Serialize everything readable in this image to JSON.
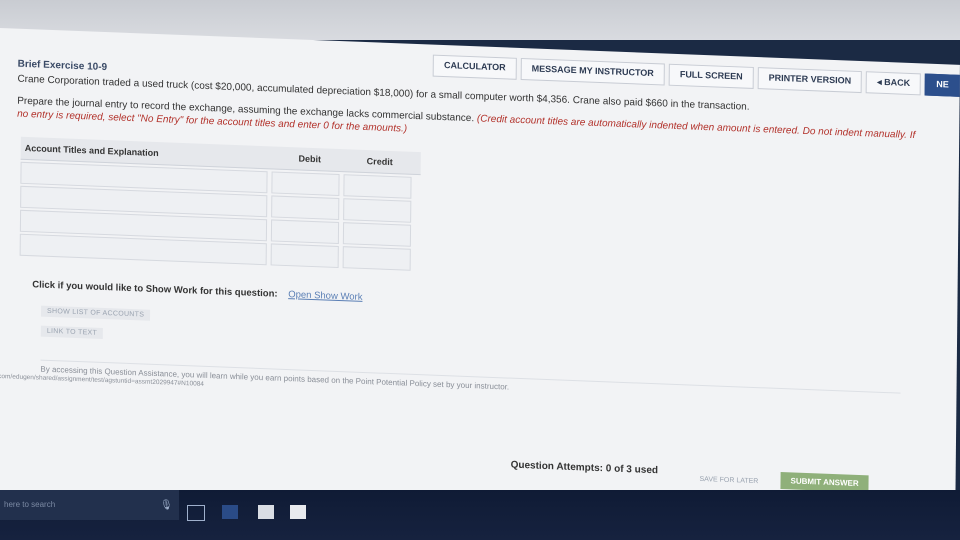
{
  "toolbar": {
    "calculator": "CALCULATOR",
    "message": "MESSAGE MY INSTRUCTOR",
    "fullscreen": "FULL SCREEN",
    "printer": "PRINTER VERSION",
    "back": "◂ BACK",
    "next": "NE"
  },
  "exercise": {
    "title": "Brief Exercise 10-9",
    "description": "Crane Corporation traded a used truck (cost $20,000, accumulated depreciation $18,000) for a small computer worth $4,356. Crane also paid $660 in the transaction.",
    "instruction_a": "Prepare the journal entry to record the exchange, assuming the exchange lacks commercial substance.",
    "instruction_b": "(Credit account titles are automatically indented when amount is entered. Do not indent manually. If no entry is required, select \"No Entry\" for the account titles and enter 0 for the amounts.)"
  },
  "table": {
    "col_account": "Account Titles and Explanation",
    "col_debit": "Debit",
    "col_credit": "Credit",
    "rows": [
      {
        "account": "",
        "debit": "",
        "credit": ""
      },
      {
        "account": "",
        "debit": "",
        "credit": ""
      },
      {
        "account": "",
        "debit": "",
        "credit": ""
      },
      {
        "account": "",
        "debit": "",
        "credit": ""
      }
    ]
  },
  "showwork": {
    "prompt": "Click if you would like to Show Work for this question:",
    "link": "Open Show Work"
  },
  "buttons": {
    "list_accounts": "SHOW LIST OF ACCOUNTS",
    "link_text": "LINK TO TEXT",
    "save_later": "SAVE FOR LATER",
    "submit": "SUBMIT ANSWER"
  },
  "assist_text": "By accessing this Question Assistance, you will learn while you earn points based on the Point Potential Policy set by your instructor.",
  "url_text": ".com/edugen/shared/assignment/test/agstuntid=assmt2029947#N10084",
  "attempts": "Question Attempts: 0 of 3 used",
  "taskbar": {
    "search": "here to search"
  }
}
